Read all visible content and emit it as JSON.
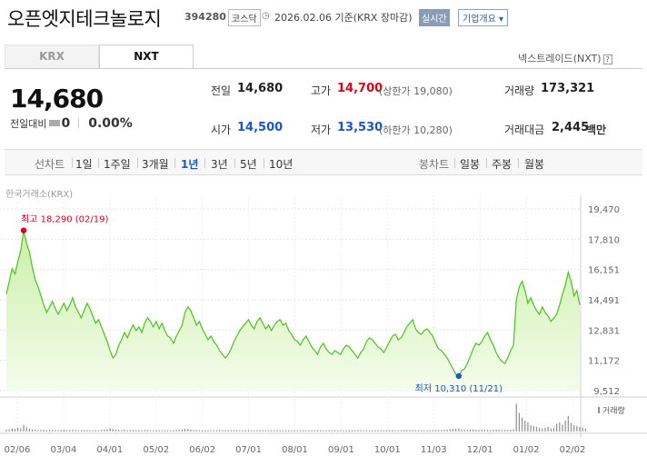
{
  "header": {
    "stock_name": "오픈엣지테크놀로지",
    "code": "394280",
    "market_badge": "코스닥",
    "datetime": "2026.02.06 기준(KRX 장마감)",
    "realtime_button": "실시간",
    "company_info_button": "기업개요 ▾"
  },
  "tabs": [
    {
      "label": "KRX",
      "selected": false
    },
    {
      "label": "NXT",
      "selected": true
    }
  ],
  "nxt_link": "넥스트레이드(NXT)",
  "quote": {
    "price": "14,680",
    "change_label": "전일대비",
    "change_value": "0",
    "change_pct": "0.00%"
  },
  "stats": {
    "prev_close_label": "전일",
    "prev_close": "14,680",
    "high_label": "고가",
    "high": "14,700",
    "upper_limit": "(상한가 19,080)",
    "volume_label": "거래량",
    "volume": "173,321",
    "open_label": "시가",
    "open": "14,500",
    "low_label": "저가",
    "low": "13,530",
    "lower_limit": "(하한가 10,280)",
    "amount_label": "거래대금",
    "amount": "2,445",
    "amount_unit": "백만"
  },
  "toolbar": {
    "line_chart_label": "선차트",
    "periods": [
      "1일",
      "1주일",
      "3개월",
      "1년",
      "3년",
      "5년",
      "10년"
    ],
    "selected_period": "1년",
    "candle_chart_label": "봉차트",
    "candle_periods": [
      "일봉",
      "주봉",
      "월봉"
    ]
  },
  "source_note": "한국거래소(KRX)",
  "colors": {
    "line": "#4cc11f",
    "area_top": "#cbf0a8",
    "area_bottom": "#f4fcec",
    "up": "#e0001b",
    "down": "#1b56c2",
    "volume": "#8f8f8f"
  },
  "chart_data": {
    "type": "area",
    "y_ticks": [
      "19,470",
      "17,810",
      "16,151",
      "14,491",
      "12,831",
      "11,172",
      "9,512"
    ],
    "ylim": [
      9512,
      19470
    ],
    "x_ticks": [
      "02/06",
      "03/04",
      "04/01",
      "05/02",
      "06/02",
      "07/01",
      "08/01",
      "09/01",
      "10/01",
      "11/03",
      "12/01",
      "01/02",
      "02/02"
    ],
    "high_annotation": "최고 18,290 (02/19)",
    "high_value": 18290,
    "high_index": 6,
    "low_annotation": "최저 10,310 (11/21)",
    "low_value": 10310,
    "low_index": 157,
    "volume_label": "거래량",
    "series": [
      {
        "values": [
          14800,
          15500,
          16200,
          15900,
          16600,
          17200,
          18290,
          17600,
          17100,
          16300,
          15600,
          15200,
          14700,
          14200,
          13800,
          14100,
          14400,
          14000,
          13700,
          14000,
          14300,
          13900,
          14200,
          14600,
          14100,
          13800,
          13500,
          13900,
          14300,
          14000,
          13600,
          13200,
          13400,
          13000,
          12600,
          12200,
          11700,
          11300,
          11500,
          12000,
          12300,
          12700,
          12400,
          12800,
          13100,
          12800,
          13000,
          12700,
          13200,
          13500,
          13300,
          13000,
          13300,
          12900,
          13200,
          12800,
          12500,
          12400,
          12100,
          12500,
          12800,
          13100,
          13800,
          14100,
          13900,
          13500,
          13100,
          13300,
          12900,
          12600,
          12300,
          12500,
          12200,
          12000,
          11700,
          11500,
          11300,
          11500,
          11800,
          12200,
          12500,
          12800,
          13000,
          13200,
          13400,
          13100,
          12900,
          13300,
          13500,
          13200,
          12900,
          13100,
          12800,
          13100,
          13300,
          13400,
          13100,
          13200,
          12800,
          12600,
          12300,
          12200,
          12000,
          12300,
          12500,
          12200,
          11900,
          11700,
          11500,
          11900,
          12100,
          11800,
          11600,
          11500,
          11700,
          11600,
          11500,
          11800,
          12000,
          11900,
          11700,
          11500,
          11300,
          11600,
          11800,
          12200,
          12400,
          12300,
          12100,
          11900,
          11800,
          11600,
          11900,
          12200,
          12500,
          12600,
          12300,
          12400,
          12700,
          13000,
          13200,
          13400,
          12900,
          12700,
          12600,
          12800,
          12900,
          12700,
          12500,
          12100,
          11800,
          11700,
          11500,
          11300,
          11000,
          10700,
          10400,
          10310,
          10600,
          10700,
          11000,
          11400,
          11800,
          12100,
          12000,
          12200,
          12500,
          12700,
          12300,
          12000,
          11600,
          11300,
          11100,
          11000,
          11300,
          11700,
          12000,
          14500,
          15200,
          15500,
          15000,
          14300,
          14600,
          14200,
          13900,
          13700,
          14100,
          13800,
          13600,
          13300,
          13500,
          13700,
          14200,
          14800,
          15300,
          16000,
          15500,
          14700,
          15000,
          14200
        ]
      }
    ],
    "volume": [
      0.06,
      0.07,
      0.09,
      0.08,
      0.12,
      0.1,
      0.22,
      0.14,
      0.09,
      0.07,
      0.06,
      0.05,
      0.05,
      0.06,
      0.04,
      0.05,
      0.06,
      0.05,
      0.04,
      0.05,
      0.06,
      0.04,
      0.05,
      0.06,
      0.05,
      0.04,
      0.04,
      0.05,
      0.05,
      0.04,
      0.04,
      0.05,
      0.04,
      0.05,
      0.06,
      0.07,
      0.1,
      0.08,
      0.06,
      0.05,
      0.05,
      0.06,
      0.04,
      0.05,
      0.05,
      0.04,
      0.04,
      0.04,
      0.05,
      0.05,
      0.04,
      0.04,
      0.04,
      0.04,
      0.04,
      0.04,
      0.04,
      0.04,
      0.04,
      0.05,
      0.05,
      0.06,
      0.09,
      0.08,
      0.06,
      0.05,
      0.05,
      0.04,
      0.04,
      0.04,
      0.04,
      0.04,
      0.04,
      0.04,
      0.05,
      0.05,
      0.04,
      0.04,
      0.04,
      0.05,
      0.05,
      0.04,
      0.04,
      0.05,
      0.05,
      0.04,
      0.04,
      0.04,
      0.05,
      0.04,
      0.04,
      0.04,
      0.04,
      0.04,
      0.04,
      0.04,
      0.04,
      0.04,
      0.04,
      0.04,
      0.04,
      0.04,
      0.04,
      0.04,
      0.04,
      0.04,
      0.04,
      0.04,
      0.05,
      0.04,
      0.04,
      0.04,
      0.04,
      0.04,
      0.04,
      0.04,
      0.04,
      0.04,
      0.04,
      0.04,
      0.04,
      0.04,
      0.05,
      0.04,
      0.04,
      0.04,
      0.04,
      0.04,
      0.04,
      0.04,
      0.04,
      0.04,
      0.04,
      0.05,
      0.05,
      0.04,
      0.04,
      0.04,
      0.05,
      0.05,
      0.05,
      0.05,
      0.04,
      0.04,
      0.04,
      0.04,
      0.04,
      0.04,
      0.04,
      0.05,
      0.05,
      0.05,
      0.06,
      0.06,
      0.07,
      0.08,
      0.09,
      0.1,
      0.07,
      0.06,
      0.05,
      0.06,
      0.07,
      0.06,
      0.05,
      0.06,
      0.06,
      0.05,
      0.05,
      0.05,
      0.06,
      0.06,
      0.05,
      0.05,
      0.05,
      0.06,
      0.07,
      0.9,
      0.6,
      0.45,
      0.35,
      0.3,
      0.2,
      0.18,
      0.15,
      0.12,
      0.1,
      0.12,
      0.15,
      0.1,
      0.12,
      0.25,
      0.3,
      0.22,
      0.35,
      0.5,
      0.28,
      0.2,
      0.18,
      0.15,
      0.12,
      0.1
    ]
  }
}
